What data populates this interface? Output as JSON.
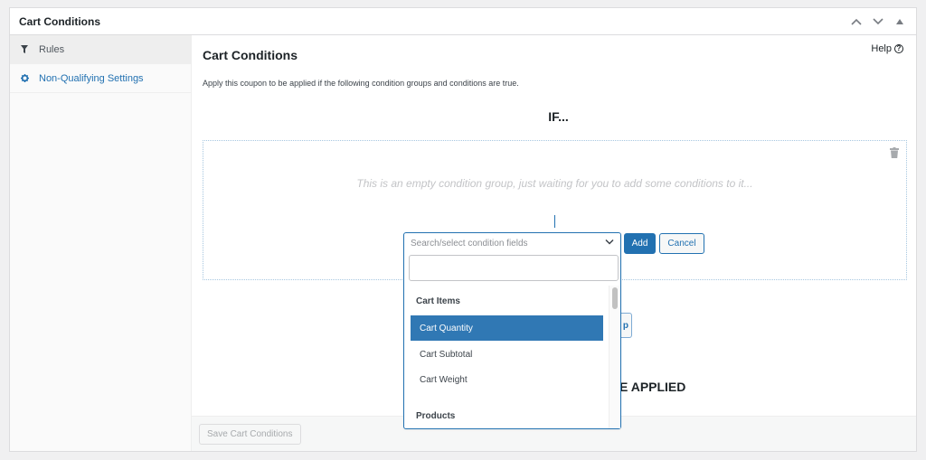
{
  "metabox": {
    "title": "Cart Conditions",
    "actions": [
      "move-up",
      "move-down",
      "toggle-panel"
    ]
  },
  "sidebar": {
    "tabs": [
      {
        "label": "Rules",
        "icon": "filter-icon",
        "active": true
      },
      {
        "label": "Non-Qualifying Settings",
        "icon": "gear-icon",
        "active": false
      }
    ]
  },
  "panel": {
    "heading": "Cart Conditions",
    "help_label": "Help",
    "description": "Apply this coupon to be applied if the following condition groups and conditions are true.",
    "if_label": "IF...",
    "group": {
      "empty_text": "This is an empty condition group, just waiting for you to add some conditions to it..."
    },
    "add_label": "Add",
    "cancel_label": "Cancel",
    "partial_button_label": "p",
    "partial_then_label": "E APPLIED",
    "save_label": "Save Cart Conditions"
  },
  "condition_select": {
    "placeholder": "Search/select condition fields",
    "search_value": "",
    "groups": [
      {
        "label": "Cart Items",
        "options": [
          {
            "label": "Cart Quantity",
            "selected": true
          },
          {
            "label": "Cart Subtotal",
            "selected": false
          },
          {
            "label": "Cart Weight",
            "selected": false
          }
        ]
      },
      {
        "label": "Products",
        "options": []
      }
    ]
  },
  "colors": {
    "accent": "#2271b1",
    "selected_option": "#3078b4"
  }
}
